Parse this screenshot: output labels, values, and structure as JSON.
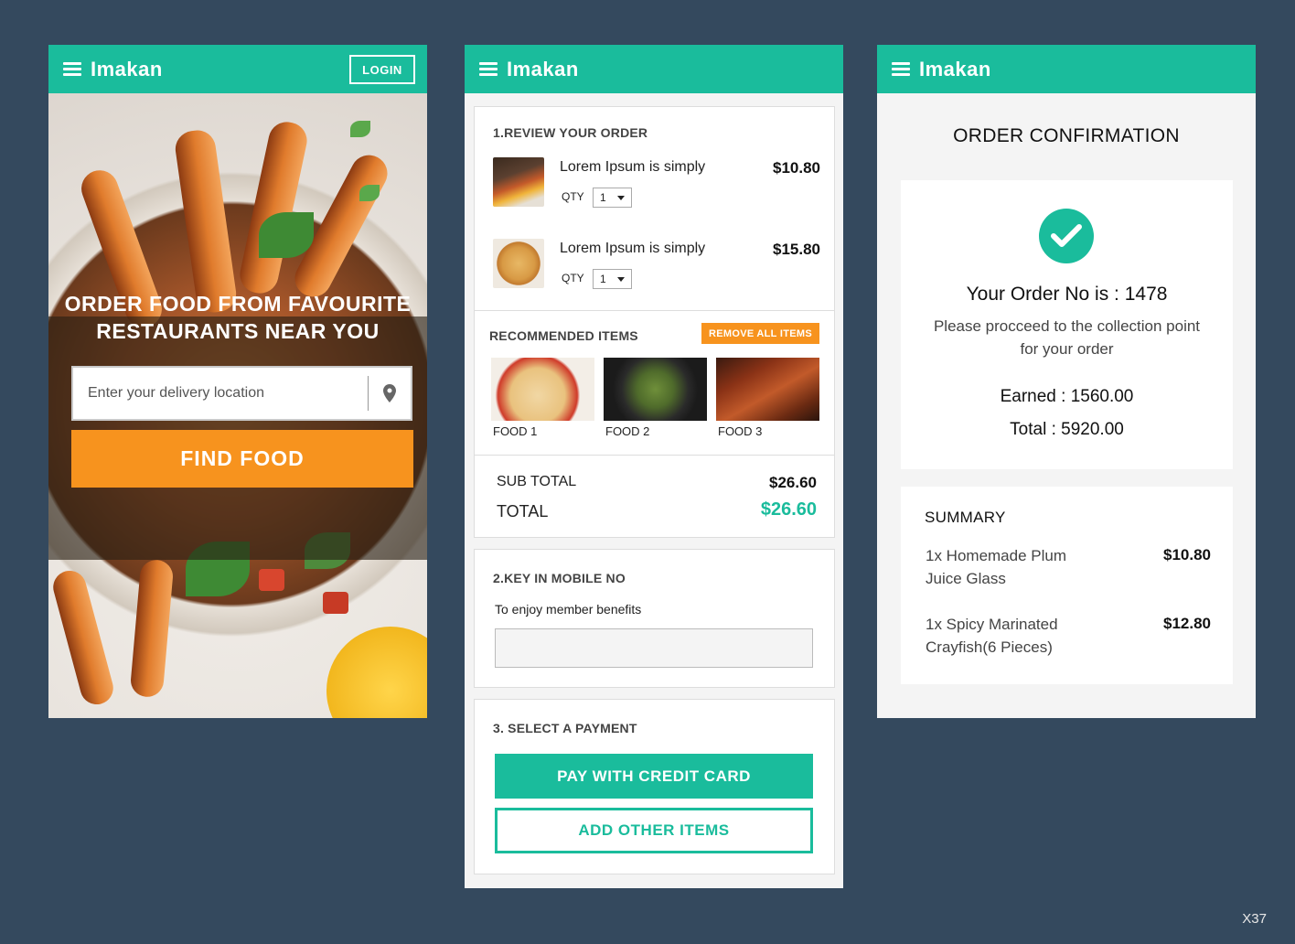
{
  "brand": "Imakan",
  "home": {
    "login_label": "LOGIN",
    "hero_line1": "ORDER FOOD FROM FAVOURITE",
    "hero_line2": "RESTAURANTS NEAR YOU",
    "location_placeholder": "Enter your delivery location",
    "find_label": "FIND FOOD"
  },
  "order": {
    "review_title": "1.REVIEW YOUR ORDER",
    "qty_label": "QTY",
    "items": [
      {
        "name": "Lorem Ipsum is simply",
        "price": "$10.80",
        "qty": "1"
      },
      {
        "name": "Lorem Ipsum is simply",
        "price": "$15.80",
        "qty": "1"
      }
    ],
    "recommended_title": "RECOMMENDED ITEMS",
    "remove_all_label": "REMOVE ALL ITEMS",
    "recommended": [
      {
        "label": "FOOD 1"
      },
      {
        "label": "FOOD 2"
      },
      {
        "label": "FOOD 3"
      }
    ],
    "subtotal_label": "SUB TOTAL",
    "subtotal_value": "$26.60",
    "total_label": "TOTAL",
    "total_value": "$26.60",
    "mobile_title": "2.KEY IN MOBILE NO",
    "mobile_subtitle": "To enjoy member benefits",
    "mobile_value": "",
    "payment_title": "3. SELECT A PAYMENT",
    "pay_credit_label": "PAY WITH CREDIT CARD",
    "add_items_label": "ADD OTHER ITEMS"
  },
  "confirmation": {
    "title": "ORDER CONFIRMATION",
    "order_no": "Your Order No is : 1478",
    "proceed_text": "Please procceed to the collection point for your order",
    "earned": "Earned : 1560.00",
    "total": "Total : 5920.00",
    "summary_title": "SUMMARY",
    "summary_items": [
      {
        "name": "1x Homemade Plum Juice Glass",
        "price": "$10.80"
      },
      {
        "name": "1x Spicy Marinated Crayfish(6 Pieces)",
        "price": "$12.80"
      }
    ]
  },
  "artboard_code": "X37",
  "colors": {
    "background": "#34495e",
    "primary": "#1abc9c",
    "accent": "#f7931e"
  }
}
